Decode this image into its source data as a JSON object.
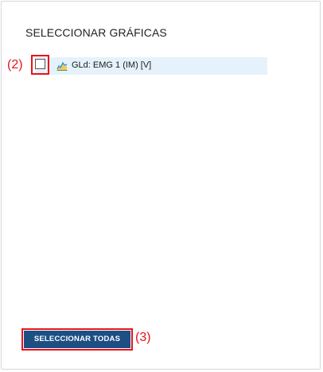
{
  "panel": {
    "title": "SELECCIONAR GRÁFICAS",
    "graphs": [
      {
        "label": "GLd: EMG 1 (IM) [V]",
        "checked": false,
        "icon": "area-chart-icon"
      }
    ],
    "select_all_label": "SELECCIONAR TODAS"
  },
  "annotations": {
    "checkbox": "(2)",
    "select_all": "(3)",
    "color": "#e8121b"
  },
  "colors": {
    "button_bg": "#1d4f84",
    "row_highlight": "#e6f2fb"
  }
}
